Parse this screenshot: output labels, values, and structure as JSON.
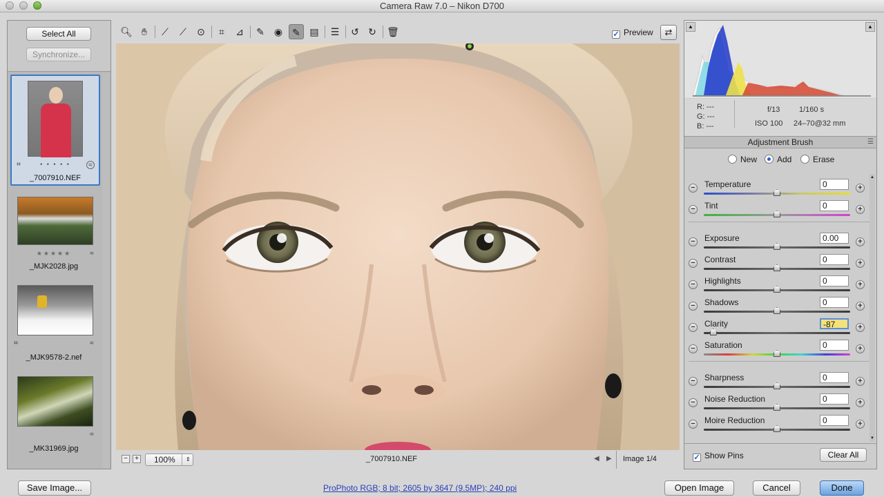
{
  "window": {
    "title": "Camera Raw 7.0  –  Nikon D700"
  },
  "filmstrip": {
    "select_all": "Select All",
    "synchronize": "Synchronize...",
    "items": [
      {
        "name": "_7007910.NEF",
        "rating": "• • • • •",
        "selected": true
      },
      {
        "name": "_MJK2028.jpg",
        "rating": "★★★★★",
        "selected": false
      },
      {
        "name": "_MJK9578-2.nef",
        "rating": "",
        "selected": false
      },
      {
        "name": "_MK31969.jpg",
        "rating": "",
        "selected": false
      }
    ]
  },
  "toolbar": {
    "tools": [
      "zoom-tool",
      "hand-tool",
      "white-balance-tool",
      "color-sampler-tool",
      "targeted-adjustment-tool",
      "crop-tool",
      "straighten-tool",
      "spot-removal-tool",
      "red-eye-removal-tool",
      "adjustment-brush-tool",
      "graduated-filter-tool",
      "open-preferences",
      "rotate-ccw",
      "rotate-cw",
      "delete"
    ],
    "preview_label": "Preview"
  },
  "viewer": {
    "zoom": "100%",
    "filename": "_7007910.NEF",
    "image_counter": "Image 1/4"
  },
  "info": {
    "r_label": "R:",
    "r_value": "---",
    "g_label": "G:",
    "g_value": "---",
    "b_label": "B:",
    "b_value": "---",
    "aperture": "f/13",
    "shutter": "1/160 s",
    "iso": "ISO 100",
    "lens": "24–70@32 mm"
  },
  "adjustment_brush": {
    "title": "Adjustment Brush",
    "modes": [
      {
        "label": "New",
        "selected": false
      },
      {
        "label": "Add",
        "selected": true
      },
      {
        "label": "Erase",
        "selected": false
      }
    ],
    "groups": [
      [
        {
          "label": "Temperature",
          "value": "0",
          "level": 0.5,
          "track": "temp"
        },
        {
          "label": "Tint",
          "value": "0",
          "level": 0.5,
          "track": "tint"
        }
      ],
      [
        {
          "label": "Exposure",
          "value": "0.00",
          "level": 0.5,
          "track": "plain"
        },
        {
          "label": "Contrast",
          "value": "0",
          "level": 0.5,
          "track": "plain"
        },
        {
          "label": "Highlights",
          "value": "0",
          "level": 0.5,
          "track": "plain"
        },
        {
          "label": "Shadows",
          "value": "0",
          "level": 0.5,
          "track": "plain"
        },
        {
          "label": "Clarity",
          "value": "-87",
          "level": 0.065,
          "track": "plain",
          "highlight": true
        },
        {
          "label": "Saturation",
          "value": "0",
          "level": 0.5,
          "track": "sat"
        }
      ],
      [
        {
          "label": "Sharpness",
          "value": "0",
          "level": 0.5,
          "track": "plain"
        },
        {
          "label": "Noise Reduction",
          "value": "0",
          "level": 0.5,
          "track": "plain"
        },
        {
          "label": "Moire Reduction",
          "value": "0",
          "level": 0.5,
          "track": "plain"
        }
      ]
    ],
    "show_pins": "Show Pins",
    "clear_all": "Clear All"
  },
  "footer": {
    "save_image": "Save Image...",
    "workflow_link": "ProPhoto RGB; 8 bit; 2605 by 3647 (9.5MP); 240 ppi",
    "open_image": "Open Image",
    "cancel": "Cancel",
    "done": "Done"
  },
  "colors": {
    "accent": "#3a78c8",
    "highlight_field": "#f3e27a"
  }
}
